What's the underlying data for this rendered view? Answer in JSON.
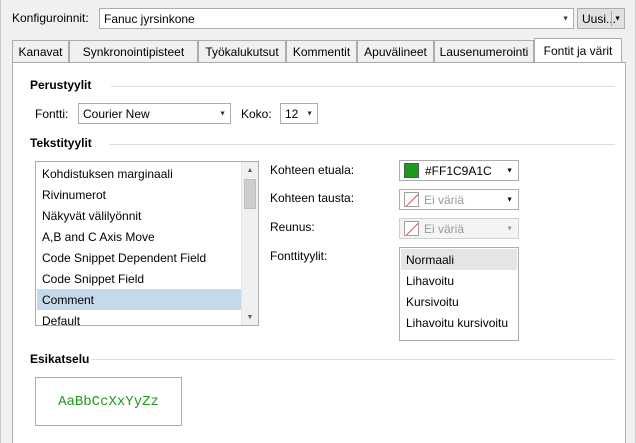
{
  "header": {
    "config_label": "Konfiguroinnit:",
    "config_value": "Fanuc jyrsinkone",
    "new_button_label": "Uusi..."
  },
  "tabs": [
    {
      "label": "Kanavat",
      "active": false
    },
    {
      "label": "Synkronointipisteet",
      "active": false
    },
    {
      "label": "Työkalukutsut",
      "active": false
    },
    {
      "label": "Kommentit",
      "active": false
    },
    {
      "label": "Apuvälineet",
      "active": false
    },
    {
      "label": "Lausenumerointi",
      "active": false
    },
    {
      "label": "Fontit ja värit",
      "active": true
    }
  ],
  "basic_styles": {
    "title": "Perustyylit",
    "font_label": "Fontti:",
    "font_value": "Courier New",
    "size_label": "Koko:",
    "size_value": "12"
  },
  "text_styles": {
    "title": "Tekstityylit",
    "items": [
      {
        "label": "Kohdistuksen marginaali",
        "selected": false
      },
      {
        "label": "Rivinumerot",
        "selected": false
      },
      {
        "label": "Näkyvät välilyönnit",
        "selected": false
      },
      {
        "label": "A,B and C Axis Move",
        "selected": false
      },
      {
        "label": "Code Snippet Dependent Field",
        "selected": false
      },
      {
        "label": "Code Snippet Field",
        "selected": false
      },
      {
        "label": "Comment",
        "selected": true
      },
      {
        "label": "Default",
        "selected": false
      }
    ],
    "foreground_label": "Kohteen etuala:",
    "foreground_value": "#FF1C9A1C",
    "foreground_color": "#1C9A1C",
    "background_label": "Kohteen tausta:",
    "background_value": "Ei väriä",
    "border_label": "Reunus:",
    "border_value": "Ei väriä",
    "font_styles_label": "Fonttityylit:",
    "font_styles": [
      {
        "label": "Normaali",
        "selected": true
      },
      {
        "label": "Lihavoitu",
        "selected": false
      },
      {
        "label": "Kursivoitu",
        "selected": false
      },
      {
        "label": "Lihavoitu kursivoitu",
        "selected": false
      }
    ]
  },
  "preview": {
    "title": "Esikatselu",
    "sample_text": "AaBbCcXxYyZz"
  },
  "icons": {
    "dropdown": "chevron-down-icon",
    "scroll_up": "scroll-up-icon",
    "scroll_down": "scroll-down-icon",
    "no_color": "no-color-icon"
  }
}
